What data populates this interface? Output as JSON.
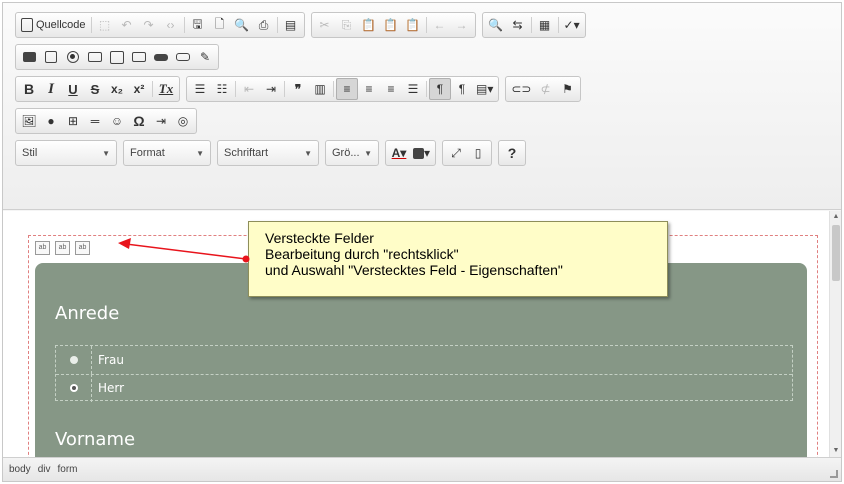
{
  "toolbar": {
    "row1": {
      "source_label": "Quellcode"
    },
    "row3": {
      "bold": "B",
      "italic": "I",
      "underline": "U",
      "strike": "S",
      "subscript": "x₂",
      "superscript": "x²",
      "remove_format": "Tx"
    },
    "row5": {
      "style_combo": "Stil",
      "format_combo": "Format",
      "font_combo": "Schriftart",
      "size_combo": "Grö...",
      "help": "?"
    }
  },
  "content": {
    "hidden_field_marker": "ab",
    "section1_title": "Anrede",
    "options": [
      {
        "label": "Frau",
        "checked": false
      },
      {
        "label": "Herr",
        "checked": true
      }
    ],
    "section2_title": "Vorname"
  },
  "tooltip": {
    "line1": "Versteckte Felder",
    "line2": "Bearbeitung durch \"rechtsklick\"",
    "line3": "und Auswahl \"Verstecktes Feld - Eigenschaften\""
  },
  "statusbar": {
    "crumbs": [
      "body",
      "div",
      "form"
    ]
  },
  "colors": {
    "form_bg": "#869786",
    "tooltip_bg": "#fffdc8",
    "arrow": "#e8141c"
  }
}
